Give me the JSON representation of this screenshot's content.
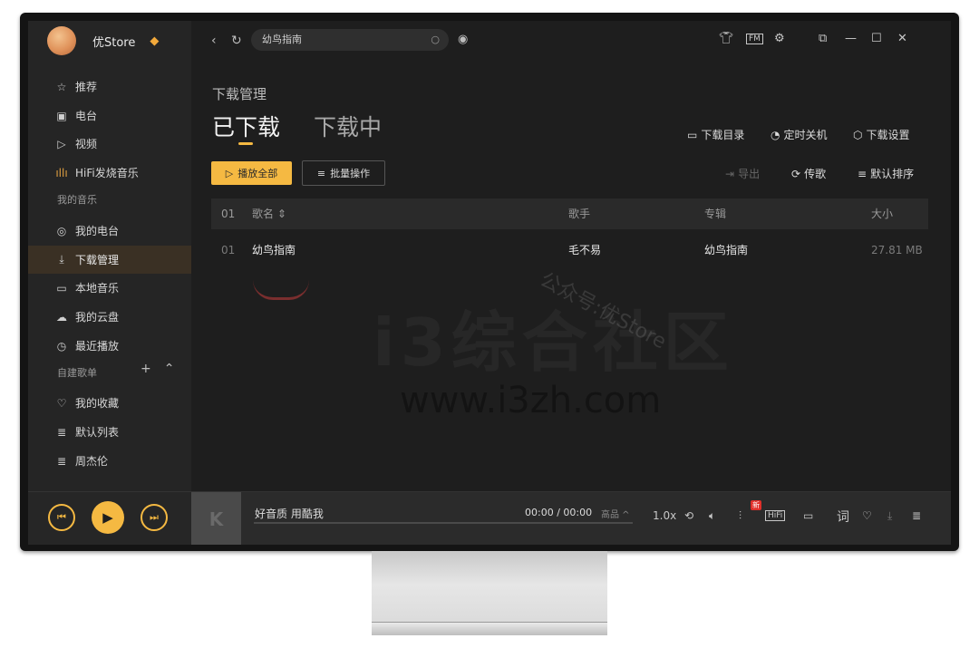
{
  "profile": {
    "username": "优Store",
    "vip_icon": "diamond-icon"
  },
  "sidebar": {
    "top_items": [
      {
        "label": "推荐",
        "icon": "star-icon"
      },
      {
        "label": "电台",
        "icon": "radio-icon"
      },
      {
        "label": "视频",
        "icon": "video-icon"
      },
      {
        "label": "HiFi发烧音乐",
        "icon": "waveform-icon"
      }
    ],
    "my_music_label": "我的音乐",
    "my_music_items": [
      {
        "label": "我的电台",
        "icon": "podcast-icon"
      },
      {
        "label": "下载管理",
        "icon": "download-icon",
        "active": true
      },
      {
        "label": "本地音乐",
        "icon": "monitor-icon"
      },
      {
        "label": "我的云盘",
        "icon": "cloud-icon"
      },
      {
        "label": "最近播放",
        "icon": "clock-icon"
      }
    ],
    "playlists_label": "自建歌单",
    "playlist_items": [
      {
        "label": "我的收藏",
        "icon": "heart-icon"
      },
      {
        "label": "默认列表",
        "icon": "playlist-icon"
      },
      {
        "label": "周杰伦",
        "icon": "playlist-icon"
      }
    ]
  },
  "search": {
    "value": "幼鸟指南"
  },
  "main": {
    "page_title": "下载管理",
    "tabs": [
      "已下载",
      "下载中"
    ],
    "actions": [
      "下载目录",
      "定时关机",
      "下载设置"
    ],
    "play_all": "播放全部",
    "batch": "批量操作",
    "tools": [
      "导出",
      "传歌",
      "默认排序"
    ],
    "columns": {
      "index": "01",
      "name": "歌名",
      "artist": "歌手",
      "album": "专辑",
      "size": "大小"
    },
    "rows": [
      {
        "index": "01",
        "name": "幼鸟指南",
        "artist": "毛不易",
        "album": "幼鸟指南",
        "size": "27.81 MB"
      }
    ]
  },
  "watermark": {
    "site": "i3综合社区",
    "url": "www.i3zh.com",
    "diag": "公众号:优Store"
  },
  "player": {
    "song": "好音质 用酷我",
    "time": "00:00 / 00:00",
    "quality": "高品 ^",
    "speed": "1.0x",
    "hifi": "HiFi",
    "lyric": "词",
    "new_badge": "新"
  },
  "colors": {
    "accent": "#f5b942",
    "active_bg": "#3a3024",
    "background": "#1e1e1e"
  }
}
